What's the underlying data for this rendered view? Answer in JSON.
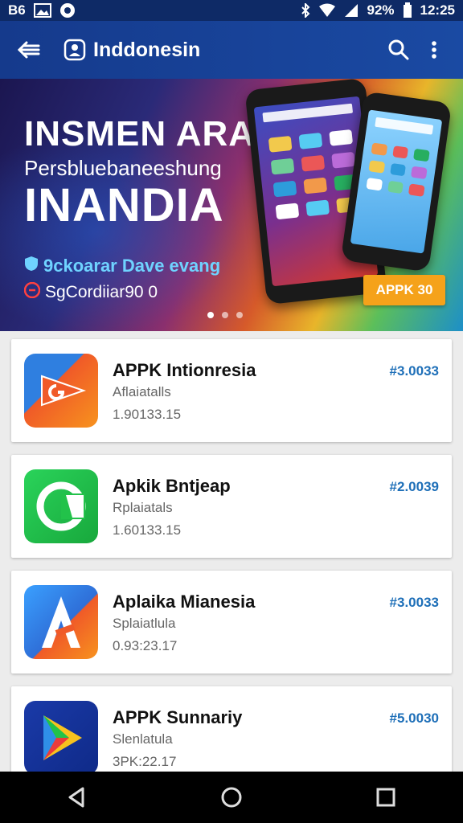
{
  "status_bar": {
    "left_text": "B6",
    "battery_percent": "92%",
    "time": "12:25"
  },
  "app_bar": {
    "title": "Inddonesin"
  },
  "banner": {
    "headline": "INSMEN ARA",
    "subheadline": "Persbluebaneeshung",
    "big_text": "INANDIA",
    "promo_line": "9ckoarar Dave evang",
    "promo_line2": "SgCordiiar90 0",
    "button_label": "APPK 30",
    "carousel_pages": 3,
    "carousel_active": 0
  },
  "apps": [
    {
      "name": "APPK Intionresia",
      "subtitle": "Aflaiatalls",
      "meta": "1.90133.15",
      "price": "#3.0033",
      "icon": "orange-play-arrow-icon",
      "color": "#f05a28"
    },
    {
      "name": "Apkik Bntjeap",
      "subtitle": "Rplaiatals",
      "meta": "1.60133.15",
      "price": "#2.0039",
      "icon": "green-chat-icon",
      "color": "#22c24a"
    },
    {
      "name": "Aplaika Mianesia",
      "subtitle": "Splaiatlula",
      "meta": "0.93:23.17",
      "price": "#3.0033",
      "icon": "letter-a-icon",
      "color": "#2e7de0"
    },
    {
      "name": "APPK Sunnariy",
      "subtitle": "Slenlatula",
      "meta": "3PK:22.17",
      "price": "#5.0030",
      "icon": "play-store-icon",
      "color": "#1a3aa8"
    }
  ],
  "nav": {
    "back": "back-icon",
    "home": "home-icon",
    "recents": "recents-icon"
  }
}
